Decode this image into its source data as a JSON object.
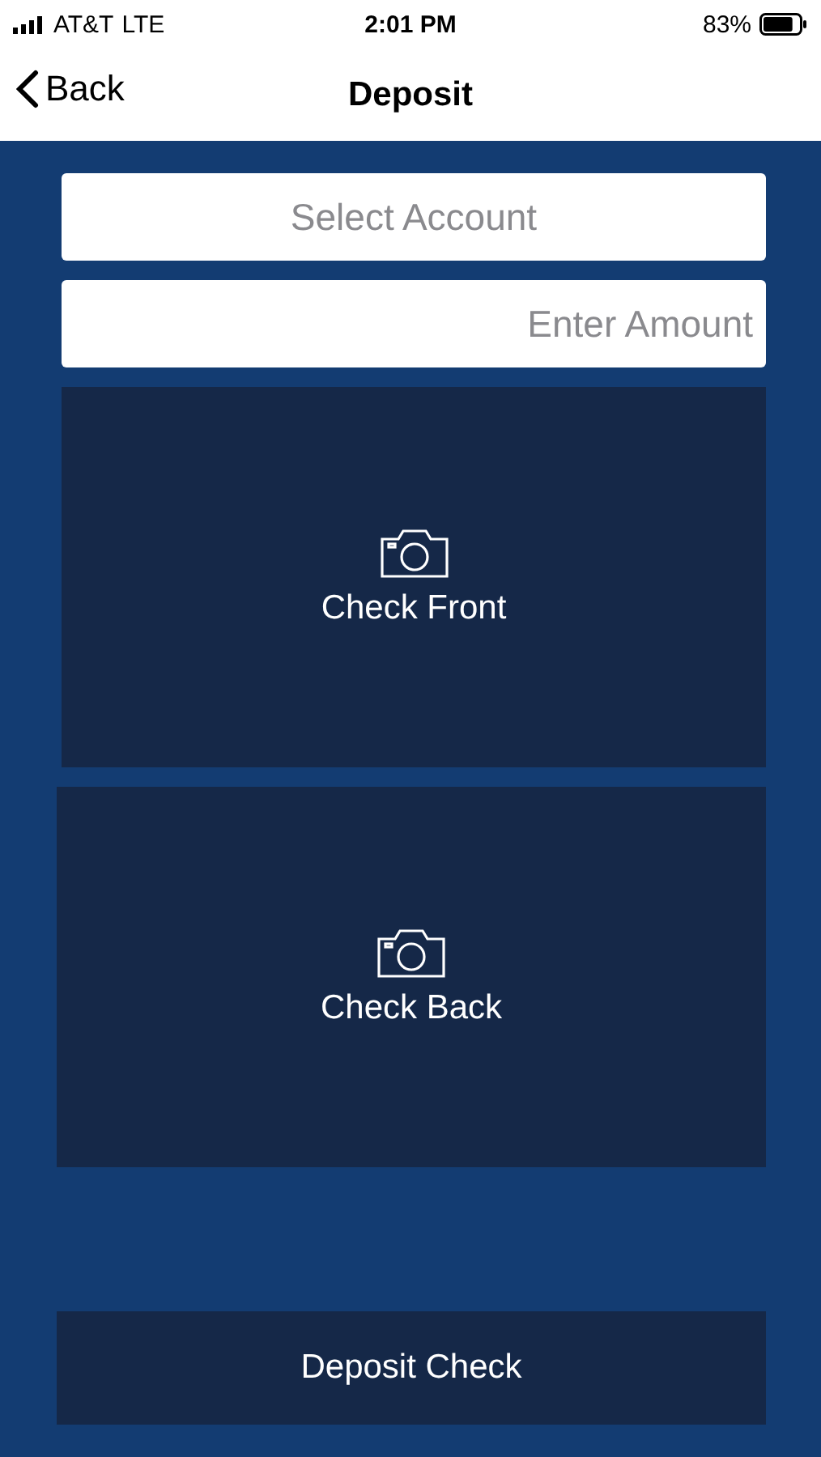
{
  "status_bar": {
    "carrier": "AT&T",
    "network": "LTE",
    "time": "2:01 PM",
    "battery": "83%"
  },
  "nav": {
    "back": "Back",
    "title": "Deposit"
  },
  "account_field": {
    "placeholder": "Select Account"
  },
  "amount_field": {
    "placeholder": "Enter Amount"
  },
  "capture_panels": [
    {
      "label": "Check Front"
    },
    {
      "label": "Check Back"
    }
  ],
  "submit_button": "Deposit Check"
}
